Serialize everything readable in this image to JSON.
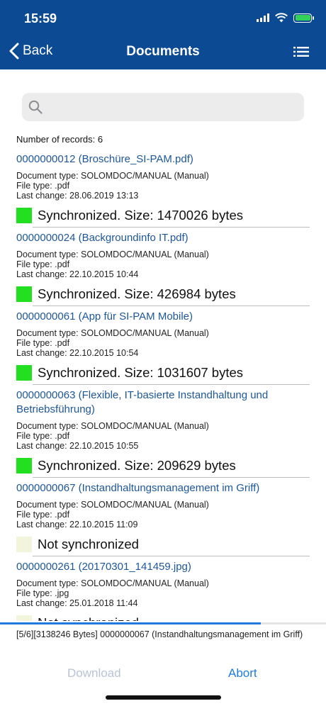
{
  "status": {
    "time": "15:59"
  },
  "nav": {
    "back_label": "Back",
    "title": "Documents"
  },
  "search": {
    "placeholder": ""
  },
  "records_label": "Number of records: 6",
  "colors": {
    "header": "#0c4a93",
    "synced": "#22e01f",
    "unsynced": "#f3f4dc",
    "link": "#1d5799",
    "accent": "#1f7be0"
  },
  "records": [
    {
      "title": "0000000012 (Broschüre_SI-PAM.pdf)",
      "doc_type": "Document type: SOLOMDOC/MANUAL (Manual)",
      "file_type": "File type: .pdf",
      "last_change": "Last change: 28.06.2019 13:13",
      "synced": true,
      "sync_text": "Synchronized. Size: 1470026 bytes"
    },
    {
      "title": "0000000024 (Backgroundinfo IT.pdf)",
      "doc_type": "Document type: SOLOMDOC/MANUAL (Manual)",
      "file_type": "File type: .pdf",
      "last_change": "Last change: 22.10.2015 10:44",
      "synced": true,
      "sync_text": "Synchronized. Size: 426984 bytes"
    },
    {
      "title": "0000000061 (App für SI-PAM Mobile)",
      "doc_type": "Document type: SOLOMDOC/MANUAL (Manual)",
      "file_type": "File type: .pdf",
      "last_change": "Last change: 22.10.2015 10:54",
      "synced": true,
      "sync_text": "Synchronized. Size: 1031607 bytes"
    },
    {
      "title": "0000000063 (Flexible, IT-basierte Instandhaltung und Betriebsführung)",
      "doc_type": "Document type: SOLOMDOC/MANUAL (Manual)",
      "file_type": "File type: .pdf",
      "last_change": "Last change: 22.10.2015 10:55",
      "synced": true,
      "sync_text": "Synchronized. Size: 209629 bytes"
    },
    {
      "title": "0000000067 (Instandhaltungsmanagement im Griff)",
      "doc_type": "Document type: SOLOMDOC/MANUAL (Manual)",
      "file_type": "File type: .pdf",
      "last_change": "Last change: 22.10.2015 11:09",
      "synced": false,
      "sync_text": "Not synchronized"
    },
    {
      "title": "0000000261 (20170301_141459.jpg)",
      "doc_type": "Document type: SOLOMDOC/MANUAL (Manual)",
      "file_type": "File type: .jpg",
      "last_change": "Last change: 25.01.2018 11:44",
      "synced": false,
      "sync_text": "Not synchronized"
    }
  ],
  "progress": {
    "fraction": 0.8,
    "text": "[5/6][3138246 Bytes] 0000000067 (Instandhaltungsmanagement im Griff)"
  },
  "footer": {
    "download_label": "Download",
    "abort_label": "Abort"
  }
}
